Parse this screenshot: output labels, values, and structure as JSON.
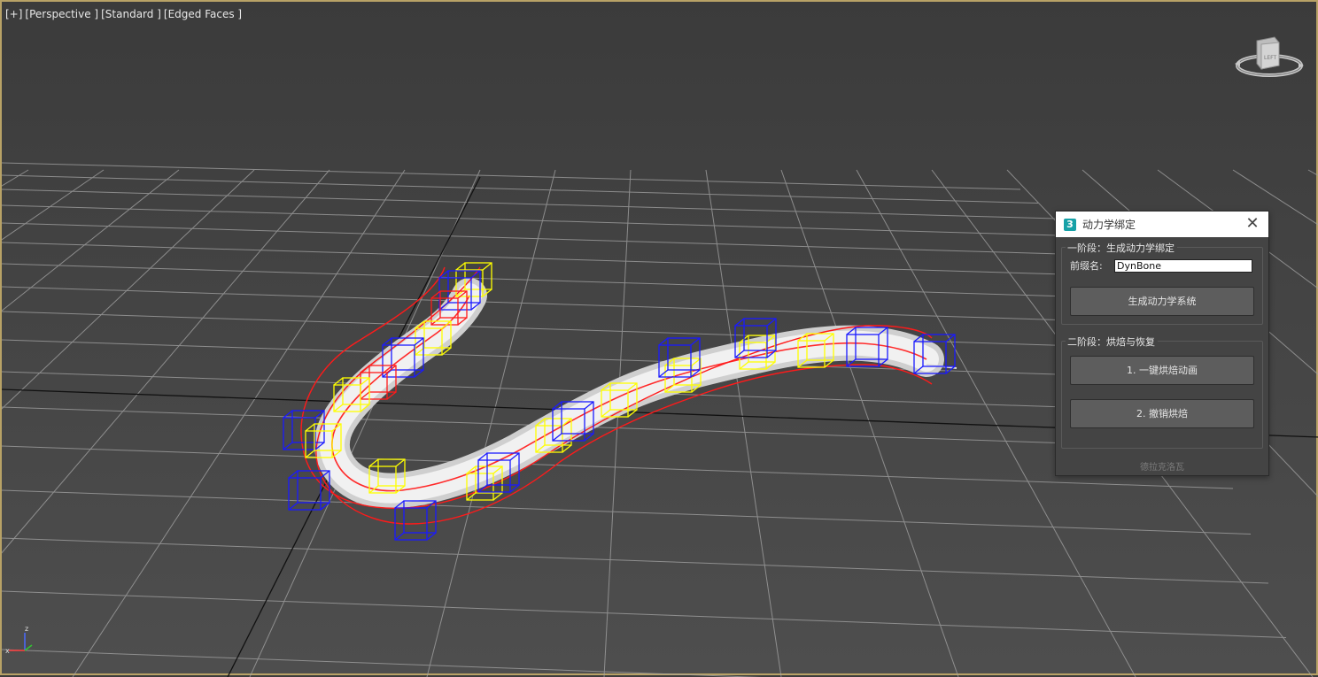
{
  "viewport": {
    "labels": [
      "[+]",
      "[Perspective ]",
      "[Standard ]",
      "[Edged Faces ]"
    ],
    "viewcube_face": "LEFT",
    "axis": {
      "z": "z",
      "x": "x"
    }
  },
  "dialog": {
    "icon": "3",
    "title": "动力学绑定",
    "close_icon": "close-icon",
    "stage1": {
      "title": "一阶段：生成动力学绑定",
      "prefix_label": "前缀名:",
      "prefix_value": "DynBone",
      "generate_button": "生成动力学系统"
    },
    "stage2": {
      "title": "二阶段：烘焙与恢复",
      "bake_button": "1. 一键烘焙动画",
      "undo_button": "2. 撤销烘焙"
    },
    "footer": "德拉克洛瓦"
  },
  "colors": {
    "viewport_border": "#b8a266",
    "grid": "#9a9a9a",
    "bounding_red": "#ff1a1a",
    "bone_yellow": "#ffff00",
    "bone_blue": "#1a1aff",
    "snake_body": "#e8e8e8",
    "accent_teal": "#16a1a7"
  }
}
